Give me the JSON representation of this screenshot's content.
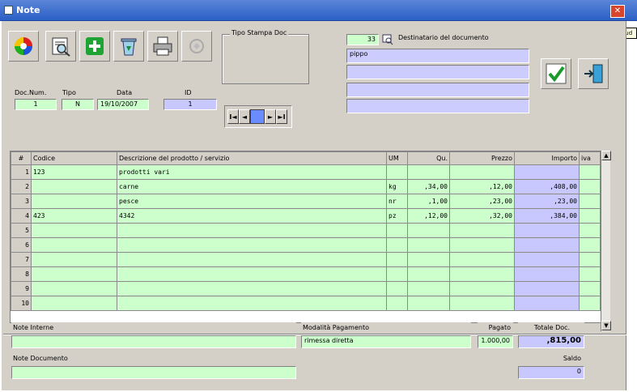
{
  "window": {
    "title": "Note",
    "close_symbol": "✕",
    "tooltip": "Chiud"
  },
  "toolbar": {
    "buttons": [
      "palette-icon",
      "preview-icon",
      "add-icon",
      "recycle-icon",
      "printer-icon",
      "disabled-icon"
    ],
    "tipo_stampa_label": "Tipo Stampa Doc"
  },
  "doc": {
    "num_label": "Doc.Num.",
    "num": "1",
    "tipo_label": "Tipo",
    "tipo": "N",
    "data_label": "Data",
    "data": "19/10/2007",
    "id_label": "ID",
    "id": "1"
  },
  "nav": {
    "first": "I◄",
    "prev": "◄",
    "next": "►",
    "last": "►I"
  },
  "recipient": {
    "code": "33",
    "label": "Destinatario del documento",
    "lines": [
      "pippo",
      "",
      "",
      ""
    ]
  },
  "actions": {
    "confirm": "check-icon",
    "exit": "exit-door-icon"
  },
  "grid": {
    "columns": [
      "#",
      "Codice",
      "Descrizione del prodotto / servizio",
      "UM",
      "Qu.",
      "Prezzo",
      "Importo",
      "iva"
    ],
    "rows": [
      [
        "1",
        "123",
        "prodotti vari",
        "",
        "",
        "",
        "",
        ""
      ],
      [
        "2",
        "",
        "carne",
        "kg",
        ",34,00",
        ",12,00",
        ",408,00",
        ""
      ],
      [
        "3",
        "",
        "pesce",
        "nr",
        ",1,00",
        ",23,00",
        ",23,00",
        ""
      ],
      [
        "4",
        "423",
        "4342",
        "pz",
        ",12,00",
        ",32,00",
        ",384,00",
        ""
      ],
      [
        "5",
        "",
        "",
        "",
        "",
        "",
        "",
        ""
      ],
      [
        "6",
        "",
        "",
        "",
        "",
        "",
        "",
        ""
      ],
      [
        "7",
        "",
        "",
        "",
        "",
        "",
        "",
        ""
      ],
      [
        "8",
        "",
        "",
        "",
        "",
        "",
        "",
        ""
      ],
      [
        "9",
        "",
        "",
        "",
        "",
        "",
        "",
        ""
      ],
      [
        "10",
        "",
        "",
        "",
        "",
        "",
        "",
        ""
      ]
    ]
  },
  "footer": {
    "note_interne_label": "Note Interne",
    "note_interne": "",
    "note_documento_label": "Note Documento",
    "note_documento": "",
    "pagamento_label": "Modalità Pagamento",
    "pagamento": "rimessa diretta",
    "pagato_label": "Pagato",
    "pagato": "1.000,00",
    "totale_label": "Totale Doc.",
    "totale": ",815,00",
    "saldo_label": "Saldo",
    "saldo": "0"
  }
}
